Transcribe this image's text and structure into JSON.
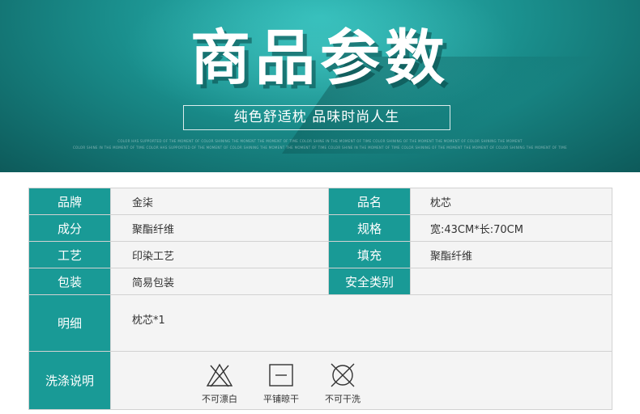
{
  "banner": {
    "title": "商品参数",
    "subtitle": "纯色舒适枕  品味时尚人生",
    "fine_print_1": "COLOR HAS SUPPORTED OF THE MOMENT OF COLOR SHINING THE MOMENT THE MOMENT OF TIME COLOR SHINE IN THE MOMENT OF TIME COLOR SHINING OF THE MOMENT THE MOMENT OF COLOR SHINING THE MOMENT",
    "fine_print_2": "COLOR SHINE IN THE MOMENT OF TIME COLOR HAS SUPPORTED OF THE MOMENT OF COLOR SHINING THE MOMENT THE MOMENT OF TIME COLOR SHINE IN THE MOMENT OF TIME COLOR SHINING OF THE MOMENT THE MOMENT OF COLOR SHINING THE MOMENT OF TIME"
  },
  "specs": {
    "brand_label": "品牌",
    "brand_value": "金柒",
    "name_label": "品名",
    "name_value": "枕芯",
    "material_label": "成分",
    "material_value": "聚酯纤维",
    "size_label": "规格",
    "size_value": "宽:43CM*长:70CM",
    "craft_label": "工艺",
    "craft_value": "印染工艺",
    "filling_label": "填充",
    "filling_value": "聚酯纤维",
    "package_label": "包装",
    "package_value": "简易包装",
    "safety_label": "安全类别",
    "safety_value": "",
    "detail_label": "明细",
    "detail_value": "枕芯*1",
    "wash_label": "洗涤说明"
  },
  "care": [
    {
      "icon": "no-bleach-icon",
      "label": "不可漂白"
    },
    {
      "icon": "flat-dry-icon",
      "label": "平铺晾干"
    },
    {
      "icon": "no-dry-clean-icon",
      "label": "不可干洗"
    }
  ],
  "colors": {
    "header_teal": "#199a96",
    "banner_teal": "#1a8f8d",
    "value_bg": "#f4f4f4"
  }
}
